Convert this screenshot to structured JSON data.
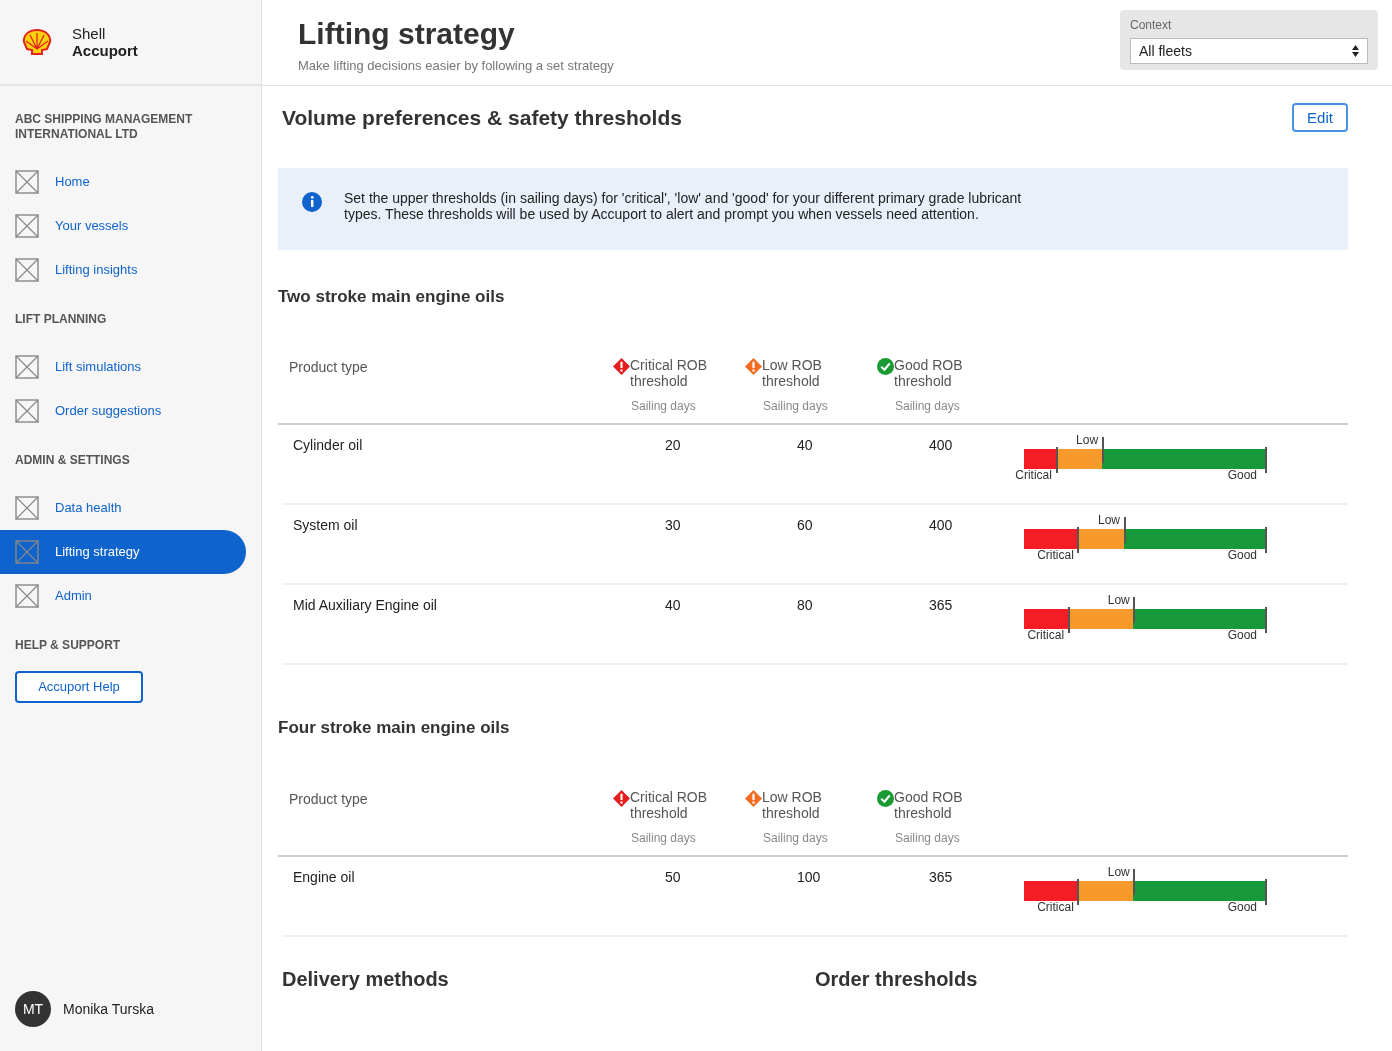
{
  "brand": {
    "line1": "Shell",
    "line2": "Accuport"
  },
  "sidebar": {
    "groups": [
      {
        "title": "ABC SHIPPING MANAGEMENT INTERNATIONAL LTD",
        "items": [
          {
            "label": "Home",
            "selected": false
          },
          {
            "label": "Your vessels",
            "selected": false
          },
          {
            "label": "Lifting insights",
            "selected": false
          }
        ]
      },
      {
        "title": "LIFT PLANNING",
        "items": [
          {
            "label": "Lift simulations",
            "selected": false
          },
          {
            "label": "Order suggestions",
            "selected": false
          }
        ]
      },
      {
        "title": "ADMIN & SETTINGS",
        "items": [
          {
            "label": "Data health",
            "selected": false
          },
          {
            "label": "Lifting strategy",
            "selected": true
          },
          {
            "label": "Admin",
            "selected": false
          }
        ]
      },
      {
        "title": "HELP & SUPPORT",
        "button": "Accuport Help"
      }
    ],
    "user": {
      "initials": "MT",
      "name": "Monika Turska"
    }
  },
  "header": {
    "title": "Lifting strategy",
    "subtitle": "Make lifting decisions easier by following a set strategy",
    "context": {
      "label": "Context",
      "value": "All fleets"
    }
  },
  "panel": {
    "title": "Volume preferences & safety thresholds",
    "edit_button": "Edit",
    "info": "Set the upper thresholds (in sailing days) for 'critical', 'low' and 'good' for your different primary grade lubricant types. These thresholds will be used by Accuport to alert and prompt you when vessels need attention.",
    "sections": [
      {
        "title": "Two stroke main engine oils",
        "product_header": "Product type",
        "columns": [
          {
            "kind": "critical",
            "label": "Critical ROB threshold",
            "unit": "Sailing days"
          },
          {
            "kind": "low",
            "label": "Low ROB threshold",
            "unit": "Sailing days"
          },
          {
            "kind": "good",
            "label": "Good ROB threshold",
            "unit": "Sailing days"
          }
        ],
        "rows": [
          {
            "product": "Cylinder oil",
            "values": [
              "20",
              "40",
              "400"
            ],
            "bar": {
              "critical_label": "Critical",
              "low_label": "Low",
              "good_label": "Good",
              "critical_mark": {
                "level": 0.13
              },
              "low_mark": {
                "level": 0.32
              }
            }
          },
          {
            "product": "System oil",
            "values": [
              "30",
              "60",
              "400"
            ],
            "bar": {
              "critical_label": "Critical",
              "low_label": "Low",
              "good_label": "Good",
              "critical_mark": {
                "level": 0.22
              },
              "low_mark": {
                "level": 0.41
              }
            }
          },
          {
            "product": "Mid Auxiliary Engine oil",
            "values": [
              "40",
              "80",
              "365"
            ],
            "bar": {
              "critical_label": "Critical",
              "low_label": "Low",
              "good_label": "Good",
              "critical_mark": {
                "level": 0.18
              },
              "low_mark": {
                "level": 0.45
              }
            }
          }
        ]
      },
      {
        "title": "Four stroke main engine oils",
        "product_header": "Product type",
        "columns": [
          {
            "kind": "critical",
            "label": "Critical ROB threshold",
            "unit": "Sailing days"
          },
          {
            "kind": "low",
            "label": "Low ROB threshold",
            "unit": "Sailing days"
          },
          {
            "kind": "good",
            "label": "Good ROB threshold",
            "unit": "Sailing days"
          }
        ],
        "rows": [
          {
            "product": "Engine oil",
            "values": [
              "50",
              "100",
              "365"
            ],
            "bar": {
              "critical_label": "Critical",
              "low_label": "Low",
              "good_label": "Good",
              "critical_mark": {
                "level": 0.22
              },
              "low_mark": {
                "level": 0.45
              }
            }
          }
        ]
      }
    ],
    "bottom_headings": [
      "Delivery methods",
      "Order thresholds"
    ]
  }
}
